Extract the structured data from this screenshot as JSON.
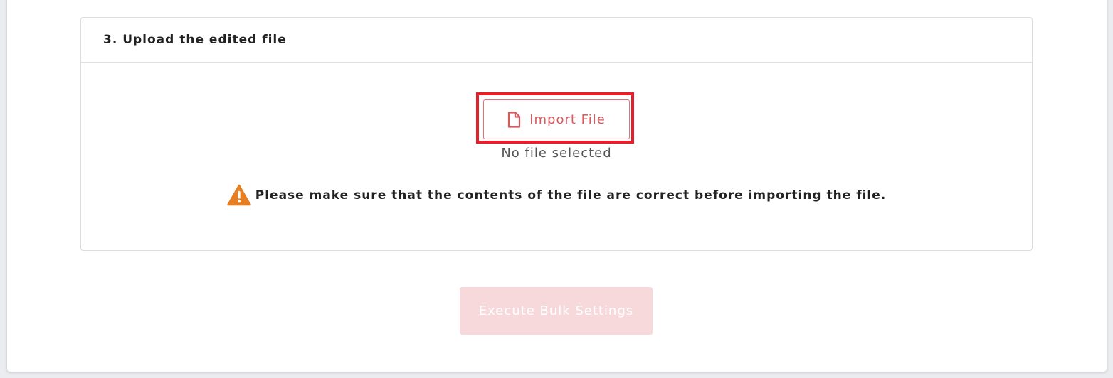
{
  "section": {
    "title": "3. Upload the edited file"
  },
  "upload": {
    "button_label": "Import File",
    "button_icon": "file-icon",
    "file_status": "No file selected",
    "warning_icon": "warning-triangle-icon",
    "warning_text": "Please make sure that the contents of the file are correct before importing the file."
  },
  "footer": {
    "execute_label": "Execute Bulk Settings",
    "execute_enabled": false
  },
  "colors": {
    "accent": "#d65a5d",
    "highlight": "#e3202b",
    "warning": "#e67e22",
    "disabled_button": "#f7d9dc"
  }
}
